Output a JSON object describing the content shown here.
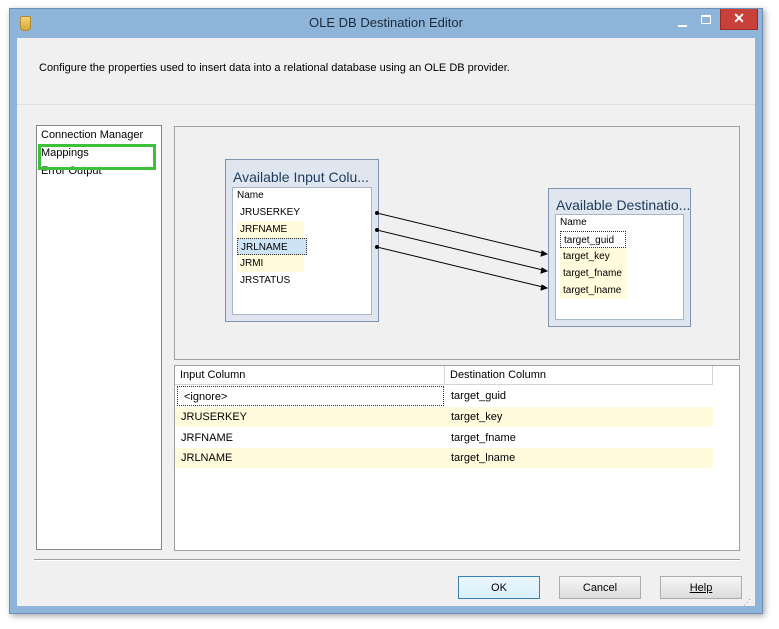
{
  "window": {
    "title": "OLE DB Destination Editor",
    "close_glyph": "✕"
  },
  "description": "Configure the properties used to insert data into a relational database using an OLE DB provider.",
  "nav": {
    "items": [
      {
        "label": "Connection Manager"
      },
      {
        "label": "Mappings"
      },
      {
        "label": "Error Output"
      }
    ],
    "selected": "Mappings",
    "highlight_color": "#3ec13a"
  },
  "mapping": {
    "input_table": {
      "title": "Available Input Colu...",
      "header": "Name",
      "columns": [
        "JRUSERKEY",
        "JRFNAME",
        "JRLNAME",
        "JRMI",
        "JRSTATUS"
      ]
    },
    "destination_table": {
      "title": "Available Destinatio...",
      "header": "Name",
      "columns": [
        "target_guid",
        "target_key",
        "target_fname",
        "target_lname"
      ]
    },
    "links": [
      {
        "from": "JRUSERKEY",
        "to": "target_key"
      },
      {
        "from": "JRFNAME",
        "to": "target_fname"
      },
      {
        "from": "JRLNAME",
        "to": "target_lname"
      }
    ]
  },
  "grid": {
    "headers": {
      "input": "Input Column",
      "destination": "Destination Column"
    },
    "rows": [
      {
        "input": "<ignore>",
        "destination": "target_guid"
      },
      {
        "input": "JRUSERKEY",
        "destination": "target_key"
      },
      {
        "input": "JRFNAME",
        "destination": "target_fname"
      },
      {
        "input": "JRLNAME",
        "destination": "target_lname"
      }
    ]
  },
  "buttons": {
    "ok": "OK",
    "cancel": "Cancel",
    "help": "Help"
  },
  "colors": {
    "title_bar": "#8fb4d9",
    "close": "#c7413a",
    "mapped_row": "#fffbdc"
  }
}
